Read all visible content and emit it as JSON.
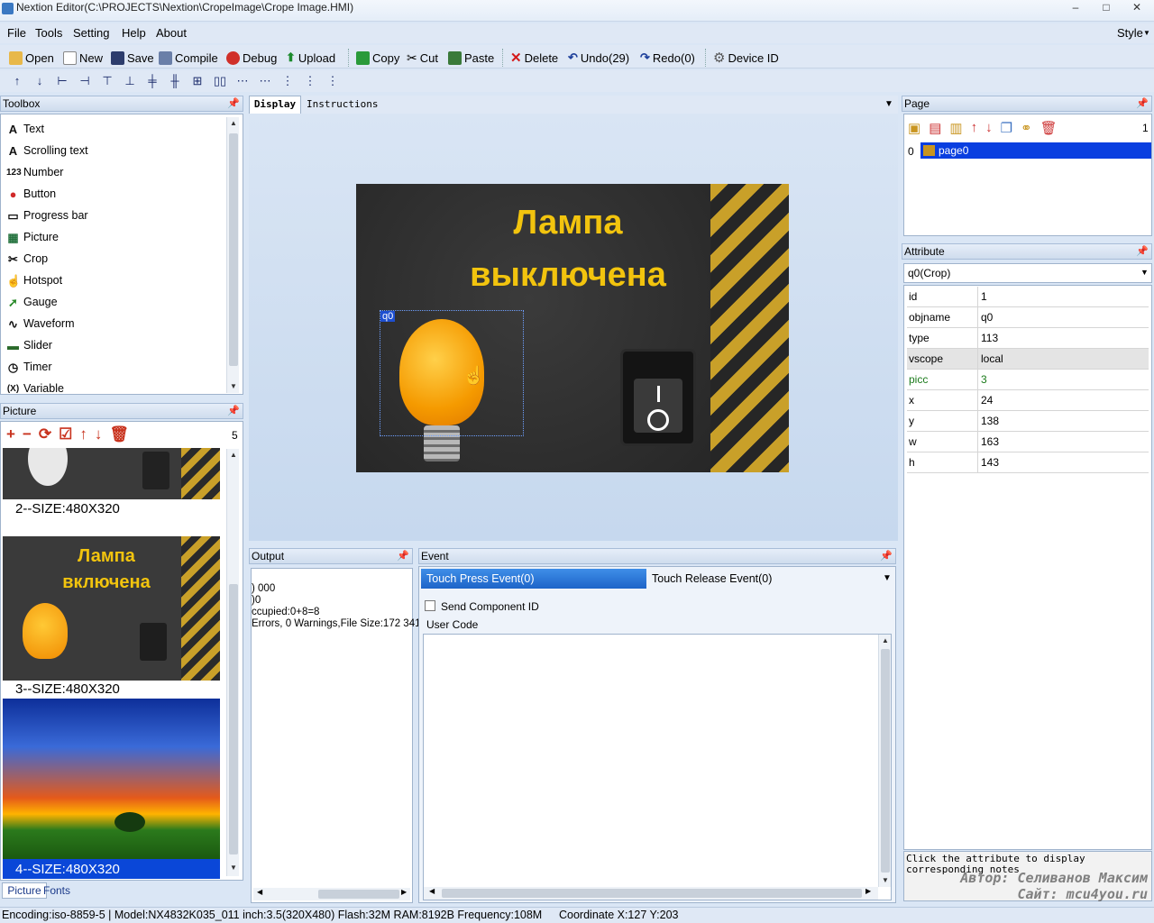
{
  "window": {
    "title": "Nextion Editor(C:\\PROJECTS\\Nextion\\CropeImage\\Crope Image.HMI)"
  },
  "menu": {
    "file": "File",
    "tools": "Tools",
    "setting": "Setting",
    "help": "Help",
    "about": "About",
    "style": "Style"
  },
  "toolbar": {
    "open": "Open",
    "new": "New",
    "save": "Save",
    "compile": "Compile",
    "debug": "Debug",
    "upload": "Upload",
    "copy": "Copy",
    "cut": "Cut",
    "paste": "Paste",
    "delete": "Delete",
    "undo": "Undo(29)",
    "redo": "Redo(0)",
    "device_id": "Device  ID"
  },
  "toolbox": {
    "title": "Toolbox",
    "items": [
      "Text",
      "Scrolling text",
      "Number",
      "Button",
      "Progress bar",
      "Picture",
      "Crop",
      "Hotspot",
      "Gauge",
      "Waveform",
      "Slider",
      "Timer",
      "Variable"
    ],
    "icons": [
      "text-icon",
      "scrolling-text-icon",
      "number-icon",
      "button-icon",
      "progress-bar-icon",
      "picture-icon",
      "crop-icon",
      "hotspot-icon",
      "gauge-icon",
      "waveform-icon",
      "slider-icon",
      "timer-icon",
      "variable-icon"
    ]
  },
  "picture_panel": {
    "title": "Picture",
    "count": "5",
    "captions": [
      "2--SIZE:480X320",
      "3--SIZE:480X320",
      "4--SIZE:480X320"
    ],
    "thumb_text_line1": "Лампа",
    "thumb_text_line2": "включена",
    "tab_picture": "Picture",
    "tab_fonts": "Fonts"
  },
  "editor": {
    "tab_display": "Display",
    "tab_instructions": "Instructions",
    "screen_title_line1": "Лампа",
    "screen_title_line2": "выключена",
    "crop_label": "q0"
  },
  "page_panel": {
    "title": "Page",
    "count": "1",
    "index": "0",
    "page_name": "page0"
  },
  "attribute_panel": {
    "title": "Attribute",
    "selected": "q0(Crop)",
    "rows": [
      {
        "k": "id",
        "v": "1"
      },
      {
        "k": "objname",
        "v": "q0"
      },
      {
        "k": "type",
        "v": "113"
      },
      {
        "k": "vscope",
        "v": "local"
      },
      {
        "k": "picc",
        "v": "3"
      },
      {
        "k": "x",
        "v": "24"
      },
      {
        "k": "y",
        "v": "138"
      },
      {
        "k": "w",
        "v": "163"
      },
      {
        "k": "h",
        "v": "143"
      }
    ],
    "note": "Click the attribute to display corresponding notes"
  },
  "output_panel": {
    "title": "Output",
    "lines": [
      ") 000",
      ")0",
      "ccupied:0+8=8",
      "Errors, 0 Warnings,File Size:172 341"
    ]
  },
  "event_panel": {
    "title": "Event",
    "tab_press": "Touch Press Event(0)",
    "tab_release": "Touch Release Event(0)",
    "send_id": "Send Component ID",
    "user_code": "User Code"
  },
  "watermark": {
    "line1": "Автор: Селиванов Максим",
    "line2": "Сайт: mcu4you.ru"
  },
  "status": {
    "text": "Encoding:iso-8859-5 | Model:NX4832K035_011  inch:3.5(320X480) Flash:32M RAM:8192B Frequency:108M",
    "coord": "Coordinate X:127  Y:203"
  },
  "colors": {
    "accent": "#0a47d8",
    "yellow_text": "#f2c40e",
    "bulb": "#f5a000"
  }
}
